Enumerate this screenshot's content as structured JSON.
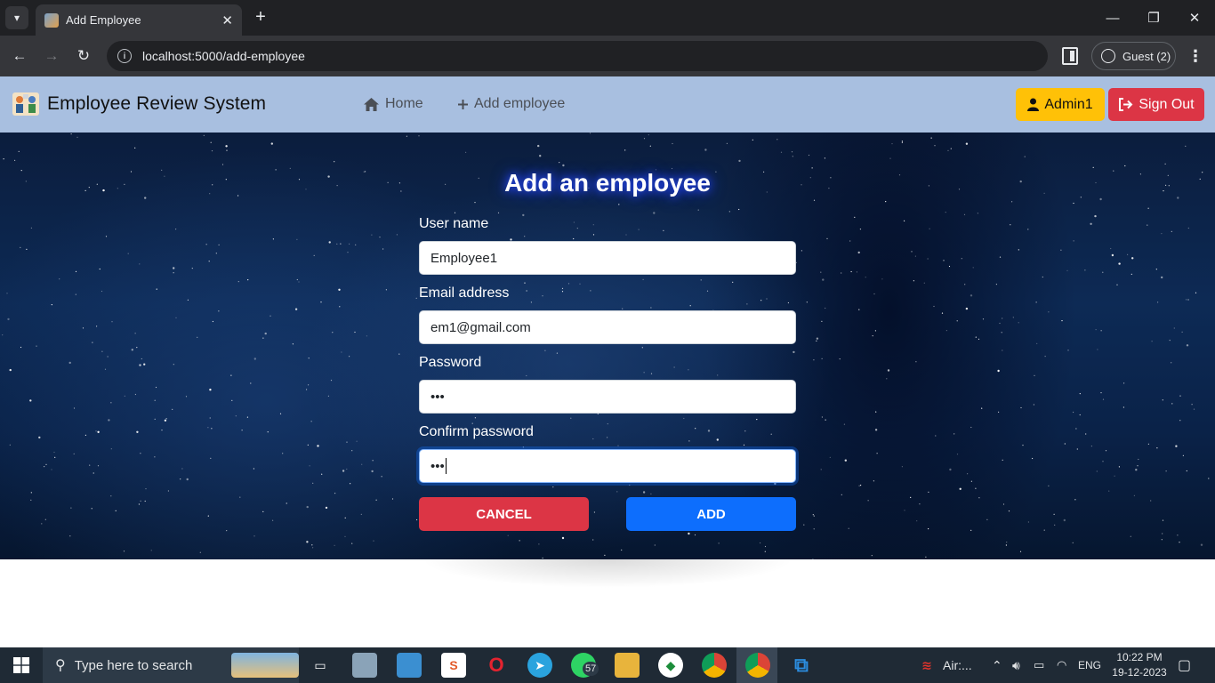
{
  "browser": {
    "tab_title": "Add Employee",
    "url": "localhost:5000/add-employee",
    "profile_label": "Guest (2)"
  },
  "navbar": {
    "brand": "Employee Review System",
    "links": [
      {
        "label": "Home",
        "icon": "home-icon"
      },
      {
        "label": "Add employee",
        "icon": "plus-icon"
      }
    ],
    "admin_label": "Admin1",
    "signout_label": "Sign Out"
  },
  "form": {
    "title": "Add an employee",
    "fields": [
      {
        "label": "User name",
        "value": "Employee1"
      },
      {
        "label": "Email address",
        "value": "em1@gmail.com"
      },
      {
        "label": "Password",
        "value": "•••"
      },
      {
        "label": "Confirm password",
        "value": "•••"
      }
    ],
    "cancel_label": "CANCEL",
    "add_label": "ADD"
  },
  "taskbar": {
    "search_placeholder": "Type here to search",
    "whatsapp_badge": "57",
    "tray_app": "Air:...",
    "language": "ENG",
    "time": "10:22 PM",
    "date": "19-12-2023"
  },
  "colors": {
    "navbar_bg": "#a8bfe0",
    "admin_button": "#ffc107",
    "signout_button": "#dc3545",
    "cancel_button": "#dc3545",
    "add_button": "#0d6efd"
  }
}
